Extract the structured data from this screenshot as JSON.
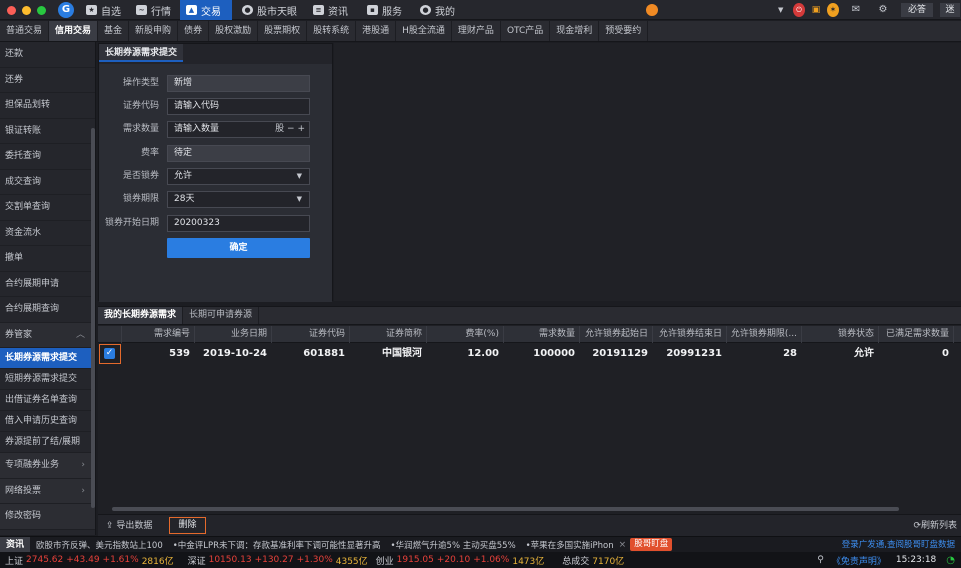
{
  "titlebar": {
    "logo": "G",
    "nav": [
      {
        "label": "自选",
        "icon": "star-icon"
      },
      {
        "label": "行情",
        "icon": "chart-icon"
      },
      {
        "label": "交易",
        "icon": "trade-icon",
        "active": true
      },
      {
        "label": "股市天眼",
        "icon": "eye-icon"
      },
      {
        "label": "资讯",
        "icon": "news-icon"
      },
      {
        "label": "服务",
        "icon": "briefcase-icon"
      },
      {
        "label": "我的",
        "icon": "user-icon"
      }
    ],
    "right_buttons": [
      "必答",
      "迷"
    ]
  },
  "menubar": [
    "普通交易",
    "信用交易",
    "基金",
    "新股申购",
    "债券",
    "股权激励",
    "股票期权",
    "股转系统",
    "港股通",
    "H股全流通",
    "理财产品",
    "OTC产品",
    "现金增利",
    "预受要约"
  ],
  "sidebar": {
    "items": [
      "还款",
      "还券",
      "担保品划转",
      "银证转账",
      "委托查询",
      "成交查询",
      "交割单查询",
      "资金流水",
      "撤单",
      "合约展期申请",
      "合约展期查询"
    ],
    "group": "券管家",
    "sub_items": [
      "长期券源需求提交",
      "短期券源需求提交",
      "出借证券名单查询",
      "借入申请历史查询",
      "券源提前了结/展期"
    ],
    "tail_items": [
      "专项融券业务",
      "网络投票",
      "修改密码"
    ]
  },
  "form": {
    "tab": "长期券源需求提交",
    "operation_type": {
      "label": "操作类型",
      "value": "新增"
    },
    "stock_code": {
      "label": "证券代码",
      "placeholder": "请输入代码"
    },
    "quantity": {
      "label": "需求数量",
      "placeholder": "请输入数量",
      "unit": "股"
    },
    "fee_rate": {
      "label": "费率",
      "value": "待定"
    },
    "lock": {
      "label": "是否锁券",
      "value": "允许"
    },
    "lock_period": {
      "label": "锁券期限",
      "value": "28天"
    },
    "start_date": {
      "label": "锁券开始日期",
      "value": "20200323"
    },
    "confirm": "确定"
  },
  "table": {
    "tabs": [
      "我的长期券源需求",
      "长期可申请券源"
    ],
    "columns": [
      "需求编号",
      "业务日期",
      "证券代码",
      "证券简称",
      "费率(%)",
      "需求数量",
      "允许锁券起始日",
      "允许锁券结束日",
      "允许锁券期限(...",
      "锁券状态",
      "已满足需求数量"
    ],
    "rows": [
      [
        "539",
        "2019-10-24",
        "601881",
        "中国银河",
        "12.00",
        "100000",
        "20191129",
        "20991231",
        "28",
        "允许",
        "0"
      ]
    ],
    "export": "导出数据",
    "delete": "删除",
    "refresh": "刷新列表"
  },
  "news": {
    "label": "资讯",
    "items": [
      "欧股市齐反弹、美元指数站上100",
      "•中金评LPR未下调：存款基准利率下调可能性显著升高",
      "•华润燃气升逾5% 主动买盘55%",
      "•苹果在多国实施iPhon"
    ],
    "badge": "股哥盯盘",
    "right": "登录广发通,查阅股哥盯盘数据"
  },
  "status": {
    "indices": [
      {
        "name": "上证",
        "price": "2745.62",
        "change": "+43.49",
        "pct": "+1.61%",
        "amount": "2816亿"
      },
      {
        "name": "深证",
        "price": "10150.13",
        "change": "+130.27",
        "pct": "+1.30%",
        "amount": "4355亿"
      },
      {
        "name": "创业",
        "price": "1915.05",
        "change": "+20.10",
        "pct": "+1.06%",
        "amount": "1473亿"
      }
    ],
    "total_label": "总成交",
    "total": "7170亿",
    "disclaimer": "《免责声明》",
    "time": "15:23:18"
  },
  "colors": {
    "accent": "#1d5fbf",
    "button_blue": "#2a7de1",
    "up_red": "#e8413a",
    "highlight_orange": "#e56a2c"
  }
}
